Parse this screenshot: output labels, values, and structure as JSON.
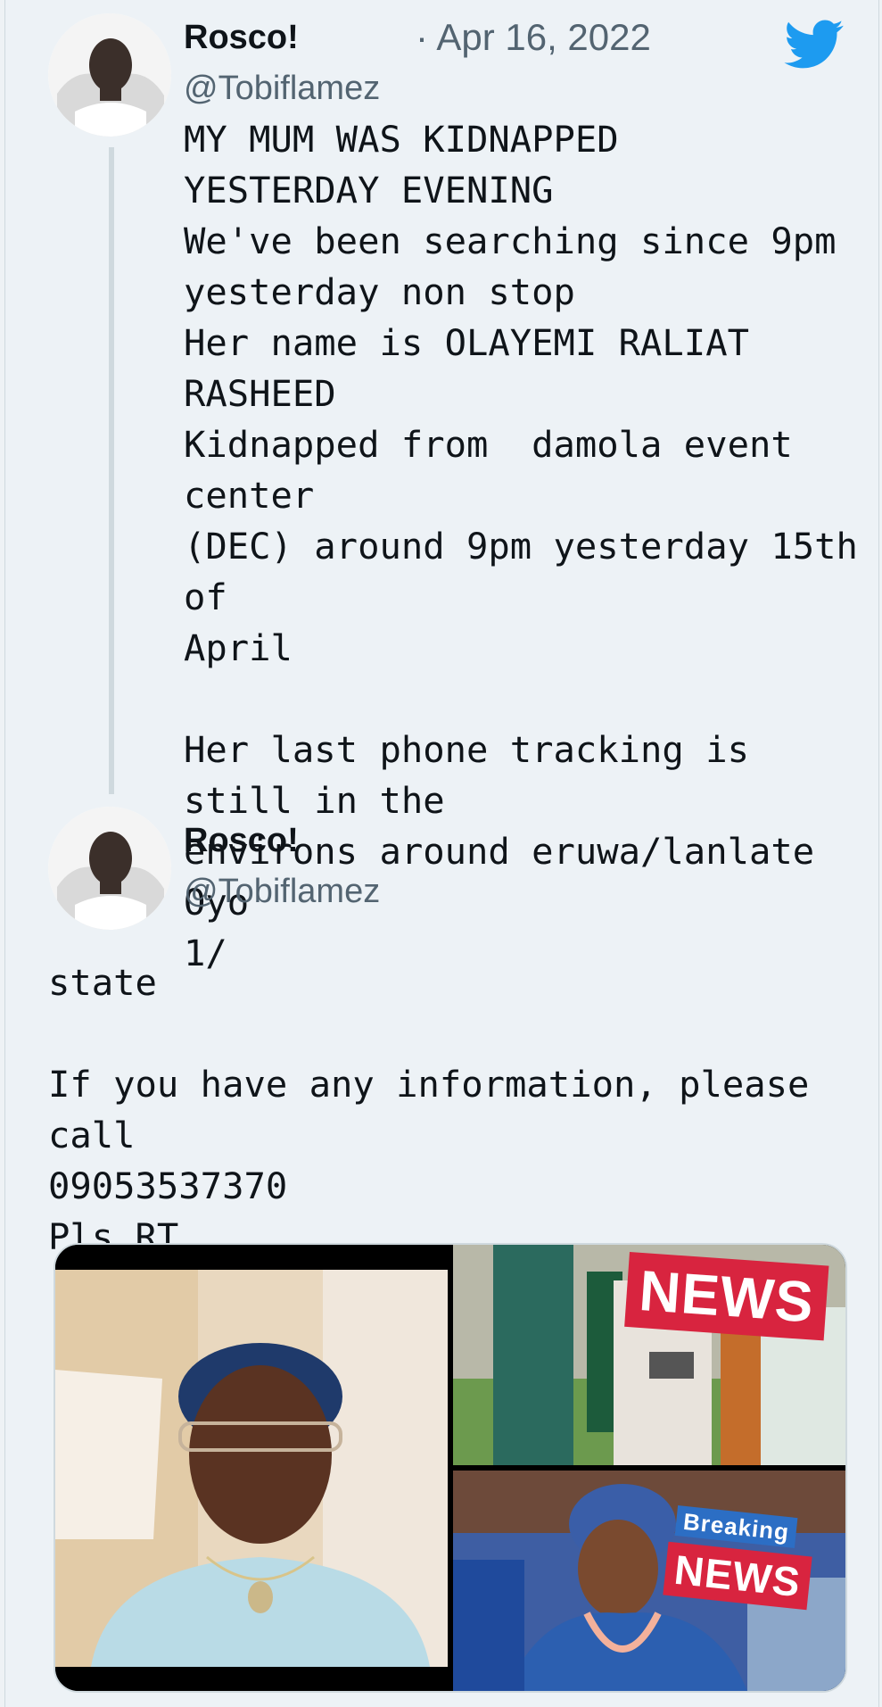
{
  "colors": {
    "background": "#edf2f6",
    "text": "#0f1419",
    "muted": "#536471",
    "twitter_blue": "#1d9bf0",
    "news_red": "#d8243f"
  },
  "tweet1": {
    "name": "Rosco!",
    "handle": "@Tobiflamez",
    "date": "· Apr 16, 2022",
    "text": "MY MUM WAS KIDNAPPED\nYESTERDAY EVENING\nWe've been searching since 9pm\nyesterday non stop\nHer name is OLAYEMI RALIAT\nRASHEED\nKidnapped from  damola event center\n(DEC) around 9pm yesterday 15th of\nApril\n\nHer last phone tracking is still in the\nenvirons around eruwa/lanlate Oyo\n1/"
  },
  "tweet2": {
    "name": "Rosco!",
    "handle": "@Tobiflamez",
    "text": "state\n\nIf you have any information, please call\n09053537370\nPls RT"
  },
  "media": {
    "photo1": {
      "icon": "portrait-photo"
    },
    "photo2": {
      "icon": "news-photo",
      "banner": "NEWS"
    },
    "photo3": {
      "icon": "breaking-news-photo",
      "banner_top": "Breaking",
      "banner_bottom": "NEWS"
    }
  }
}
